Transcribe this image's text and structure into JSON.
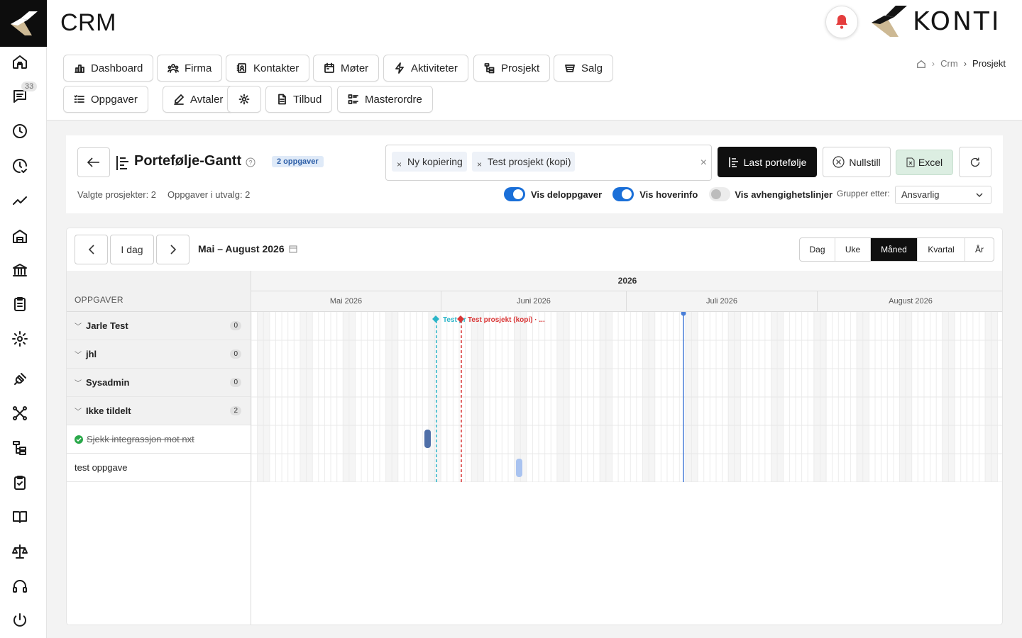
{
  "header": {
    "app_title": "CRM",
    "brand": "KONTI",
    "unread_count": "33"
  },
  "nav": {
    "row1": [
      "Dashboard",
      "Firma",
      "Kontakter",
      "Møter",
      "Aktiviteter",
      "Prosjekt",
      "Salg"
    ],
    "row2": [
      "Oppgaver",
      "Avtaler",
      "",
      "Tilbud",
      "Masterordre"
    ],
    "breadcrumb": [
      "Crm",
      "Prosjekt"
    ]
  },
  "portfolio": {
    "title": "Portefølje-Gantt",
    "task_badge": "2 oppgaver",
    "selected_projects": "Valgte prosjekter: 2",
    "tasks_in_selection": "Oppgaver i utvalg: 2",
    "chips": [
      "Ny kopiering",
      "Test prosjekt (kopi)"
    ],
    "load_button": "Last portefølje",
    "reset_button": "Nullstill",
    "excel_button": "Excel",
    "toggles": [
      {
        "label": "Vis deloppgaver",
        "on": true
      },
      {
        "label": "Vis hoverinfo",
        "on": true
      },
      {
        "label": "Vis avhengighetslinjer",
        "on": false
      }
    ],
    "group_by_label": "Grupper etter:",
    "group_by_value": "Ansvarlig"
  },
  "gantt": {
    "today_button": "I dag",
    "range_label": "Mai – August 2026",
    "views": [
      "Dag",
      "Uke",
      "Måned",
      "Kvartal",
      "År"
    ],
    "active_view": "Måned",
    "column_header": "OPPGAVER",
    "year": "2026",
    "months": [
      "Mai 2026",
      "Juni 2026",
      "Juli 2026",
      "August 2026"
    ],
    "groups": [
      {
        "name": "Jarle Test",
        "count": "0"
      },
      {
        "name": "jhl",
        "count": "0"
      },
      {
        "name": "Sysadmin",
        "count": "0"
      },
      {
        "name": "Ikke tildelt",
        "count": "2"
      }
    ],
    "tasks": [
      {
        "name": "Sjekk integrassjon mot nxt",
        "done": true
      },
      {
        "name": "test oppgave",
        "done": false
      }
    ],
    "markers": [
      "Test pr",
      "Test prosjekt (kopi) · ..."
    ],
    "colors": {
      "marker_teal": "#2bb5c8",
      "marker_red": "#d93636",
      "today_line": "#4a7fd8",
      "bar_dark": "#4f6fa8",
      "bar_light": "#a9c3f0"
    }
  }
}
